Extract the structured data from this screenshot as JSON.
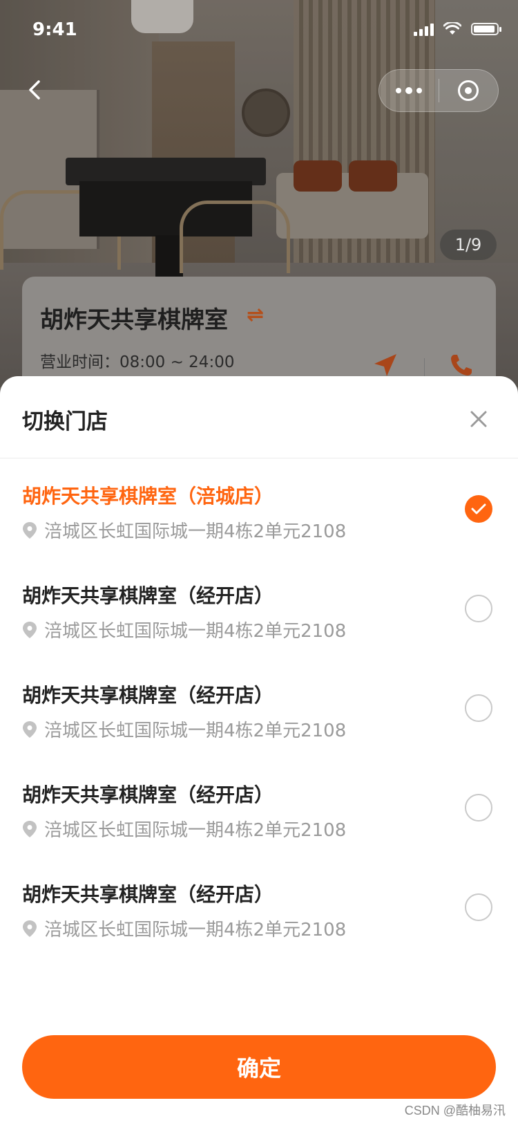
{
  "status_bar": {
    "time": "9:41"
  },
  "hero": {
    "image_counter": "1/9"
  },
  "store_card": {
    "name": "胡炸天共享棋牌室",
    "swap_icon": "⇌",
    "hours": "营业时间：08:00 ~ 24:00"
  },
  "sheet": {
    "title": "切换门店",
    "stores": [
      {
        "name": "胡炸天共享棋牌室（涪城店）",
        "address": "涪城区长虹国际城一期4栋2单元2108",
        "selected": true
      },
      {
        "name": "胡炸天共享棋牌室（经开店）",
        "address": "涪城区长虹国际城一期4栋2单元2108",
        "selected": false
      },
      {
        "name": "胡炸天共享棋牌室（经开店）",
        "address": "涪城区长虹国际城一期4栋2单元2108",
        "selected": false
      },
      {
        "name": "胡炸天共享棋牌室（经开店）",
        "address": "涪城区长虹国际城一期4栋2单元2108",
        "selected": false
      },
      {
        "name": "胡炸天共享棋牌室（经开店）",
        "address": "涪城区长虹国际城一期4栋2单元2108",
        "selected": false
      }
    ],
    "confirm_label": "确定"
  },
  "watermark": "CSDN @酷柚易汛",
  "colors": {
    "accent": "#ff6510",
    "text_primary": "#222222",
    "text_secondary": "#9a9a9a"
  },
  "icons": [
    "back-icon",
    "more-dots-icon",
    "target-icon",
    "swap-icon",
    "navigate-icon",
    "phone-icon",
    "close-icon",
    "location-pin-icon",
    "check-icon"
  ]
}
